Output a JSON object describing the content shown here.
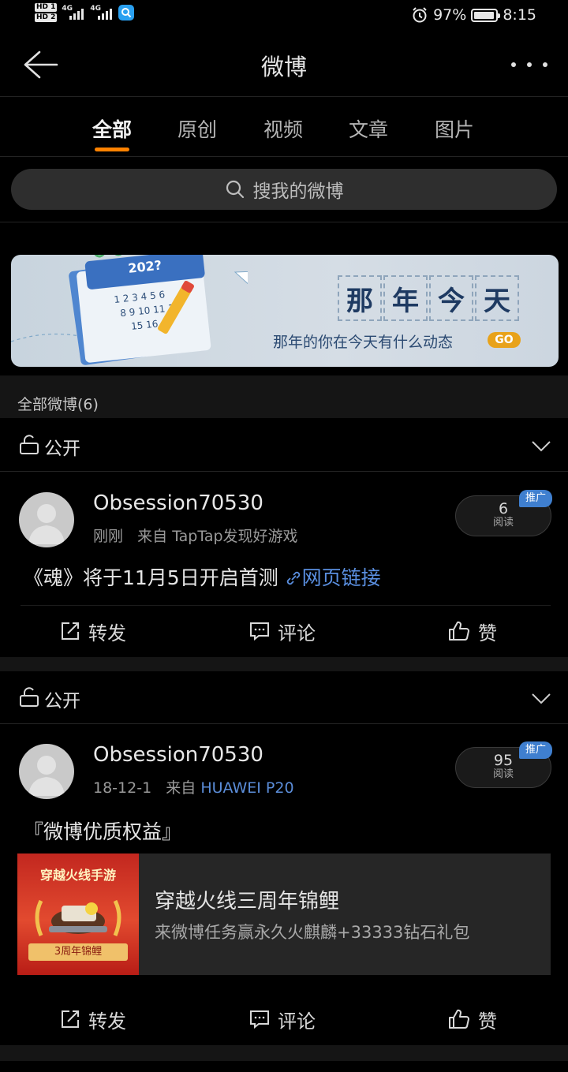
{
  "status_bar": {
    "hd1": "HD 1",
    "hd2": "HD 2",
    "net1": "4G",
    "net2": "4G",
    "battery_percent": "97%",
    "battery_level": 0.97,
    "time": "8:15"
  },
  "header": {
    "title": "微博",
    "back_icon": "arrow-left-icon",
    "more_icon": "more-dots-icon"
  },
  "tabs": [
    {
      "label": "全部",
      "active": true
    },
    {
      "label": "原创",
      "active": false
    },
    {
      "label": "视频",
      "active": false
    },
    {
      "label": "文章",
      "active": false
    },
    {
      "label": "图片",
      "active": false
    }
  ],
  "search": {
    "placeholder": "搜我的微博"
  },
  "banner": {
    "calendar_year": "202?",
    "title_chars": [
      "那",
      "年",
      "今",
      "天"
    ],
    "subtitle": "那年的你在今天有什么动态",
    "go_label": "GO"
  },
  "section": {
    "label": "全部微博(6)"
  },
  "posts": [
    {
      "visibility": "公开",
      "author": "Obsession70530",
      "time": "刚刚",
      "from_prefix": "来自",
      "source": "TapTap发现好游戏",
      "reads": "6",
      "reads_label": "阅读",
      "promo_badge": "推广",
      "text": "《魂》将于11月5日开启首测",
      "link_text": "网页链接",
      "actions": {
        "repost": "转发",
        "comment": "评论",
        "like": "赞"
      }
    },
    {
      "visibility": "公开",
      "author": "Obsession70530",
      "time": "18-12-1",
      "from_prefix": "来自",
      "source": "HUAWEI P20",
      "reads": "95",
      "reads_label": "阅读",
      "promo_badge": "推广",
      "text": "『微博优质权益』",
      "media": {
        "thumb_title": "穿越火线手游",
        "thumb_badge": "3周年锦鲤",
        "title": "穿越火线三周年锦鲤",
        "description": "来微博任务赢永久火麒麟+33333钻石礼包"
      },
      "actions": {
        "repost": "转发",
        "comment": "评论",
        "like": "赞"
      }
    }
  ],
  "colors": {
    "background": "#000000",
    "accent_orange": "#ff8200",
    "link_blue": "#5a8fe0",
    "promo_blue": "#3f7fcf",
    "panel": "#151515"
  }
}
